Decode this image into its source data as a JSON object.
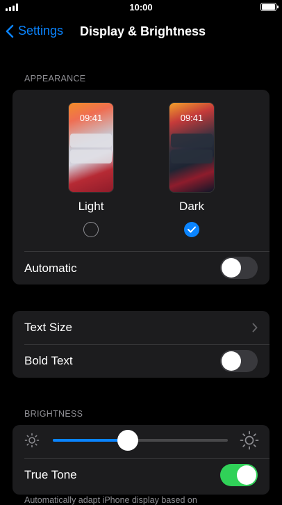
{
  "status": {
    "time": "10:00"
  },
  "nav": {
    "back_label": "Settings",
    "title": "Display & Brightness"
  },
  "appearance": {
    "header": "APPEARANCE",
    "options": [
      {
        "label": "Light",
        "preview_time": "09:41",
        "selected": false
      },
      {
        "label": "Dark",
        "preview_time": "09:41",
        "selected": true
      }
    ],
    "automatic": {
      "label": "Automatic",
      "on": false
    }
  },
  "text": {
    "text_size_label": "Text Size",
    "bold_text": {
      "label": "Bold Text",
      "on": false
    }
  },
  "brightness": {
    "header": "BRIGHTNESS",
    "level": 0.43,
    "true_tone": {
      "label": "True Tone",
      "on": true
    }
  },
  "footer": {
    "text": "Automatically adapt iPhone display based on"
  },
  "colors": {
    "accent": "#0a84ff",
    "toggle_on": "#30d158",
    "card_bg": "#1c1c1e"
  },
  "icons": [
    "signal-icon",
    "battery-icon",
    "chevron-left-icon",
    "checkmark-icon",
    "chevron-right-icon",
    "sun-small-icon",
    "sun-large-icon"
  ]
}
